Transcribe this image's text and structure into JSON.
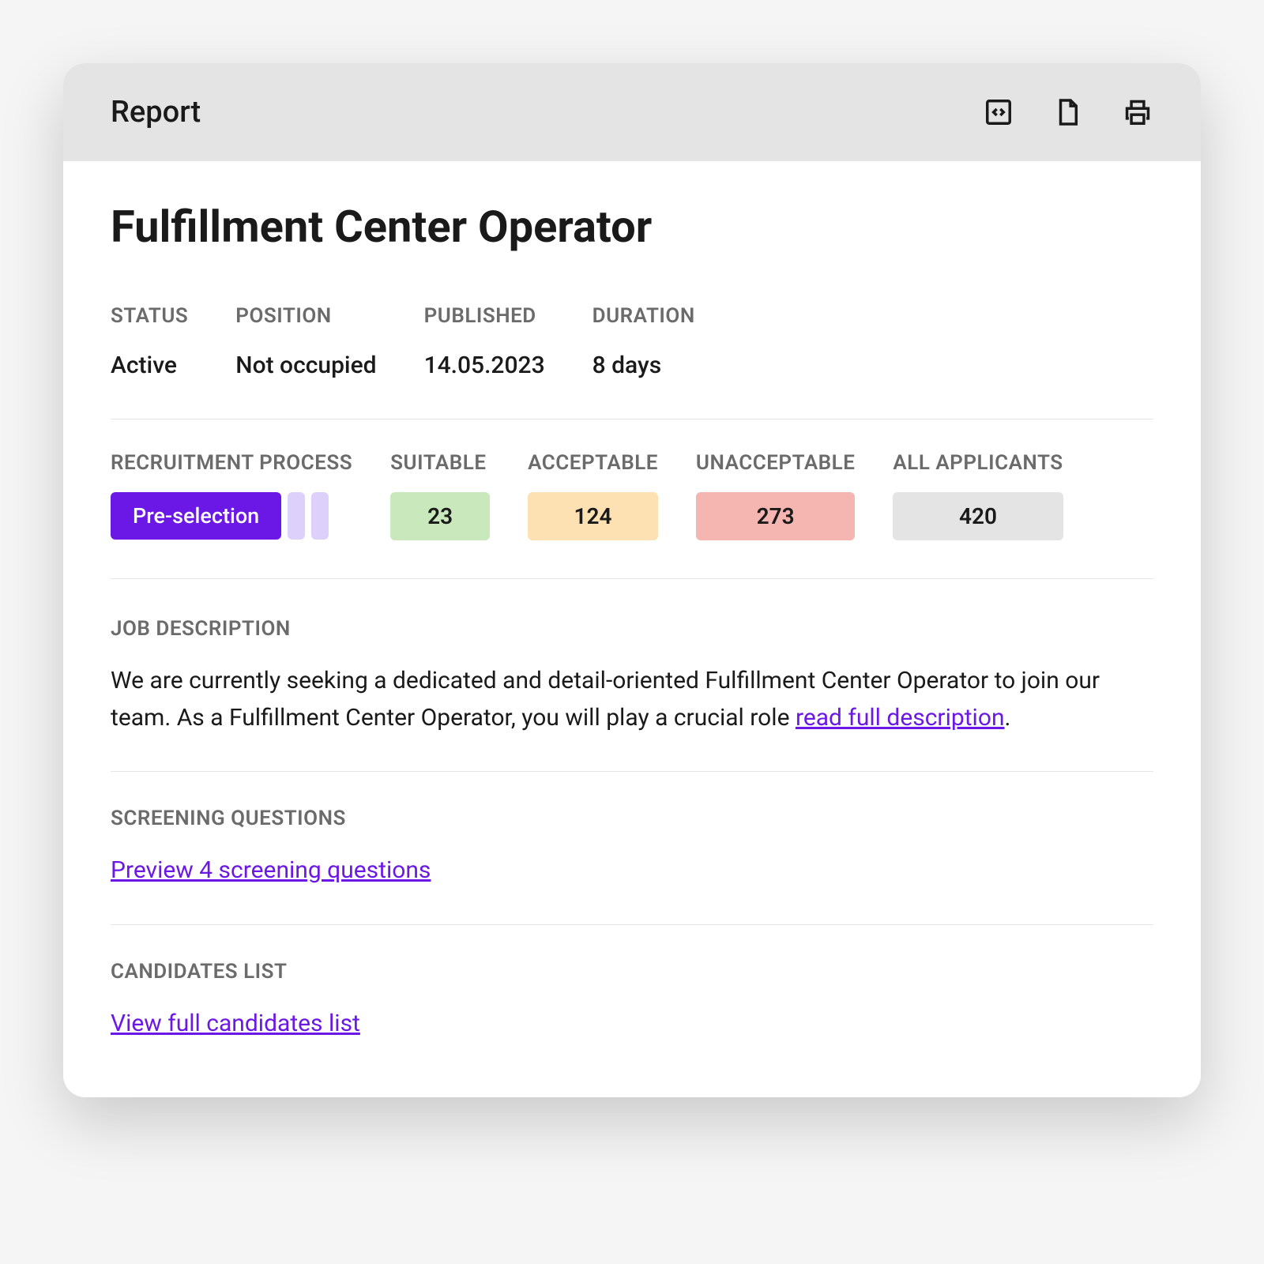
{
  "header": {
    "title": "Report"
  },
  "page": {
    "title": "Fulfillment Center Operator"
  },
  "meta": {
    "status": {
      "label": "Status",
      "value": "Active"
    },
    "position": {
      "label": "Position",
      "value": "Not occupied"
    },
    "published": {
      "label": "Published",
      "value": "14.05.2023"
    },
    "duration": {
      "label": "Duration",
      "value": "8 days"
    }
  },
  "process": {
    "label": "Recruitment Process",
    "stage": "Pre-selection"
  },
  "stats": {
    "suitable": {
      "label": "Suitable",
      "value": "23"
    },
    "acceptable": {
      "label": "Acceptable",
      "value": "124"
    },
    "unacceptable": {
      "label": "Unacceptable",
      "value": "273"
    },
    "all": {
      "label": "All Applicants",
      "value": "420"
    }
  },
  "description": {
    "label": "Job Description",
    "text": "We are currently seeking a dedicated and detail-oriented Fulfillment Center Operator to join our team. As a Fulfillment Center Operator, you will play a crucial role ",
    "link": "read full description",
    "suffix": "."
  },
  "screening": {
    "label": "Screening Questions",
    "link": "Preview 4 screening questions"
  },
  "candidates": {
    "label": "Candidates List",
    "link": "View full candidates list"
  }
}
